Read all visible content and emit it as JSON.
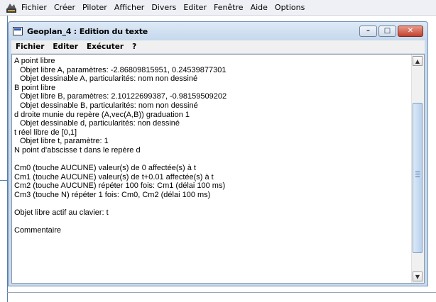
{
  "app_menu": {
    "items": [
      "Fichier",
      "Créer",
      "Piloter",
      "Afficher",
      "Divers",
      "Editer",
      "Fenêtre",
      "Aide",
      "Options"
    ]
  },
  "window": {
    "title": "Geoplan_4 : Edition du texte",
    "menu": [
      "Fichier",
      "Editer",
      "Exécuter",
      "?"
    ],
    "controls": {
      "minimize": "–",
      "maximize": "□",
      "close": "✕"
    }
  },
  "text": {
    "lines": [
      {
        "t": "A point libre",
        "ind": false
      },
      {
        "t": "Objet libre A, paramètres: -2.86809815951, 0.24539877301",
        "ind": true
      },
      {
        "t": "Objet dessinable A, particularités: nom non dessiné",
        "ind": true
      },
      {
        "t": "B point libre",
        "ind": false
      },
      {
        "t": "Objet libre B, paramètres: 2.10122699387, -0.98159509202",
        "ind": true
      },
      {
        "t": "Objet dessinable B, particularités: nom non dessiné",
        "ind": true
      },
      {
        "t": "d droite munie du repère (A,vec(A,B)) graduation 1",
        "ind": false
      },
      {
        "t": "Objet dessinable d, particularités: non dessiné",
        "ind": true
      },
      {
        "t": "t réel libre de [0,1]",
        "ind": false
      },
      {
        "t": "Objet libre t, paramètre: 1",
        "ind": true
      },
      {
        "t": "N point d'abscisse t dans le repère d",
        "ind": false
      },
      {
        "t": "",
        "ind": false
      },
      {
        "t": "Cm0 (touche AUCUNE) valeur(s) de 0 affectée(s) à t",
        "ind": false
      },
      {
        "t": "Cm1 (touche AUCUNE) valeur(s) de t+0.01 affectée(s) à t",
        "ind": false
      },
      {
        "t": "Cm2 (touche AUCUNE) répéter 100 fois: Cm1 (délai 100 ms)",
        "ind": false
      },
      {
        "t": "Cm3 (touche N) répéter 1 fois: Cm0, Cm2 (délai 100 ms)",
        "ind": false
      },
      {
        "t": "",
        "ind": false
      },
      {
        "t": "Objet libre actif au clavier: t",
        "ind": false
      },
      {
        "t": "",
        "ind": false
      },
      {
        "t": "Commentaire",
        "ind": false
      }
    ]
  },
  "scrollbar": {
    "up": "▲",
    "down": "▼"
  }
}
